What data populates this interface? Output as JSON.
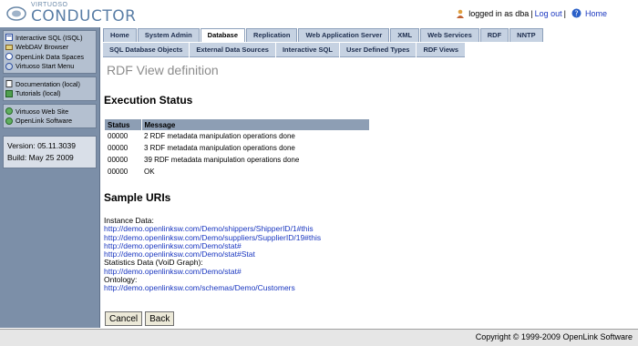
{
  "header": {
    "logo_small": "VIRTUOSO",
    "logo_big": "CONDUCTOR",
    "logged_in_text": "logged in as dba",
    "separator": "|",
    "logout_label": "Log out",
    "home_label": "Home"
  },
  "sidebar": {
    "group1": [
      {
        "label": "Interactive SQL (ISQL)",
        "icon": "isql-icon"
      },
      {
        "label": "WebDAV Browser",
        "icon": "webdav-icon"
      },
      {
        "label": "OpenLink Data Spaces",
        "icon": "ods-icon"
      },
      {
        "label": "Virtuoso Start Menu",
        "icon": "start-menu-icon"
      }
    ],
    "group2": [
      {
        "label": "Documentation (local)",
        "icon": "documentation-icon"
      },
      {
        "label": "Tutorials (local)",
        "icon": "tutorials-icon"
      }
    ],
    "group3": [
      {
        "label": "Virtuoso Web Site",
        "icon": "globe-icon"
      },
      {
        "label": "OpenLink Software",
        "icon": "globe-icon"
      }
    ],
    "version": "Version: 05.11.3039",
    "build": "Build: May 25 2009"
  },
  "tabs": [
    {
      "label": "Home",
      "active": false
    },
    {
      "label": "System Admin",
      "active": false
    },
    {
      "label": "Database",
      "active": true
    },
    {
      "label": "Replication",
      "active": false
    },
    {
      "label": "Web Application Server",
      "active": false
    },
    {
      "label": "XML",
      "active": false
    },
    {
      "label": "Web Services",
      "active": false
    },
    {
      "label": "RDF",
      "active": false
    },
    {
      "label": "NNTP",
      "active": false
    }
  ],
  "subtabs": [
    "SQL Database Objects",
    "External Data Sources",
    "Interactive SQL",
    "User Defined Types",
    "RDF Views"
  ],
  "main": {
    "page_title": "RDF View definition",
    "execution_title": "Execution Status",
    "table_headers": [
      "Status",
      "Message"
    ],
    "table_rows": [
      [
        "00000",
        "2 RDF metadata manipulation operations done"
      ],
      [
        "00000",
        "3 RDF metadata manipulation operations done"
      ],
      [
        "00000",
        "39 RDF metadata manipulation operations done"
      ],
      [
        "00000",
        "OK"
      ]
    ],
    "sample_title": "Sample URIs",
    "instance_label": "Instance Data:",
    "instance_links": [
      "http://demo.openlinksw.com/Demo/shippers/ShipperID/1#this",
      "http://demo.openlinksw.com/Demo/suppliers/SupplierID/19#this",
      "http://demo.openlinksw.com/Demo/stat#",
      "http://demo.openlinksw.com/Demo/stat#Stat"
    ],
    "stats_label": "Statistics Data (VoiD Graph):",
    "stats_link": "http://demo.openlinksw.com/Demo/stat#",
    "ontology_label": "Ontology:",
    "ontology_link": "http://demo.openlinksw.com/schemas/Demo/Customers",
    "cancel_label": "Cancel",
    "back_label": "Back"
  },
  "footer": {
    "copyright": "Copyright © 1999-2009 OpenLink Software"
  }
}
